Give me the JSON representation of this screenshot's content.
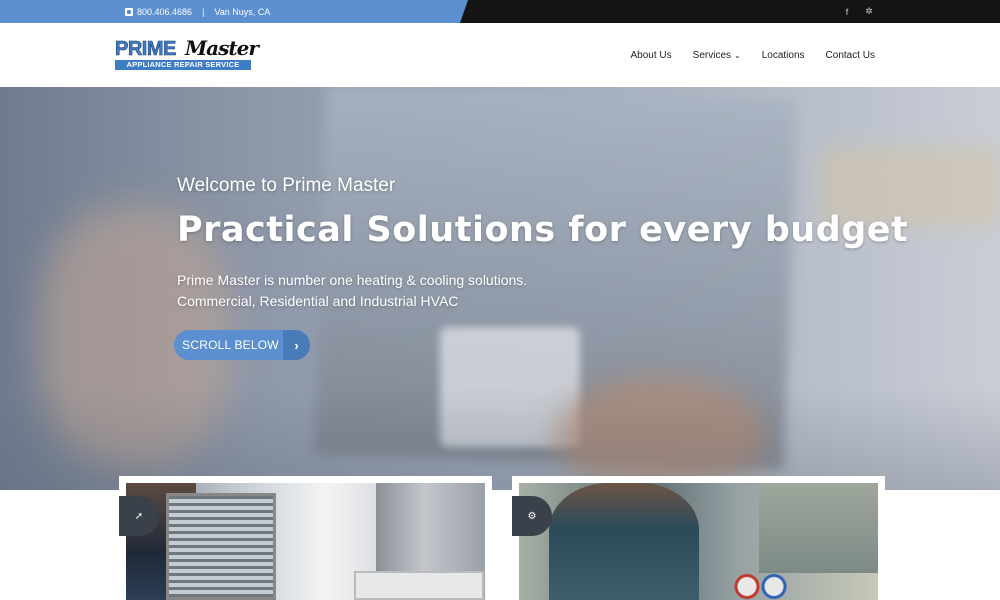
{
  "topbar": {
    "phone": "800.406.4686",
    "separator": "|",
    "location": "Van Nuys, CA",
    "icons": {
      "phone": "phone-icon",
      "facebook": "facebook-icon",
      "yelp": "yelp-icon"
    },
    "facebook_glyph": "f",
    "yelp_glyph": "✲",
    "colors": {
      "accent": "#5b8fcf",
      "dark": "#141414"
    }
  },
  "header": {
    "logo": {
      "prime": "PRIME",
      "master": "Master",
      "tagline": "APPLIANCE REPAIR SERVICE"
    },
    "nav": [
      {
        "label": "About Us"
      },
      {
        "label": "Services",
        "has_dropdown": true,
        "chevron": "⌄"
      },
      {
        "label": "Locations"
      },
      {
        "label": "Contact Us"
      }
    ]
  },
  "hero": {
    "welcome": "Welcome to Prime Master",
    "headline": "Practical Solutions for every budget",
    "description_line1": "Prime Master is number one heating & cooling solutions.",
    "description_line2": "Commercial, Residential and Industrial HVAC",
    "cta_label": "SCROLL BELOW",
    "cta_arrow": "›"
  },
  "cards": [
    {
      "badge_icon": "rocket-icon",
      "badge_glyph": "➚"
    },
    {
      "badge_icon": "gears-icon",
      "badge_glyph": "⚙"
    }
  ]
}
